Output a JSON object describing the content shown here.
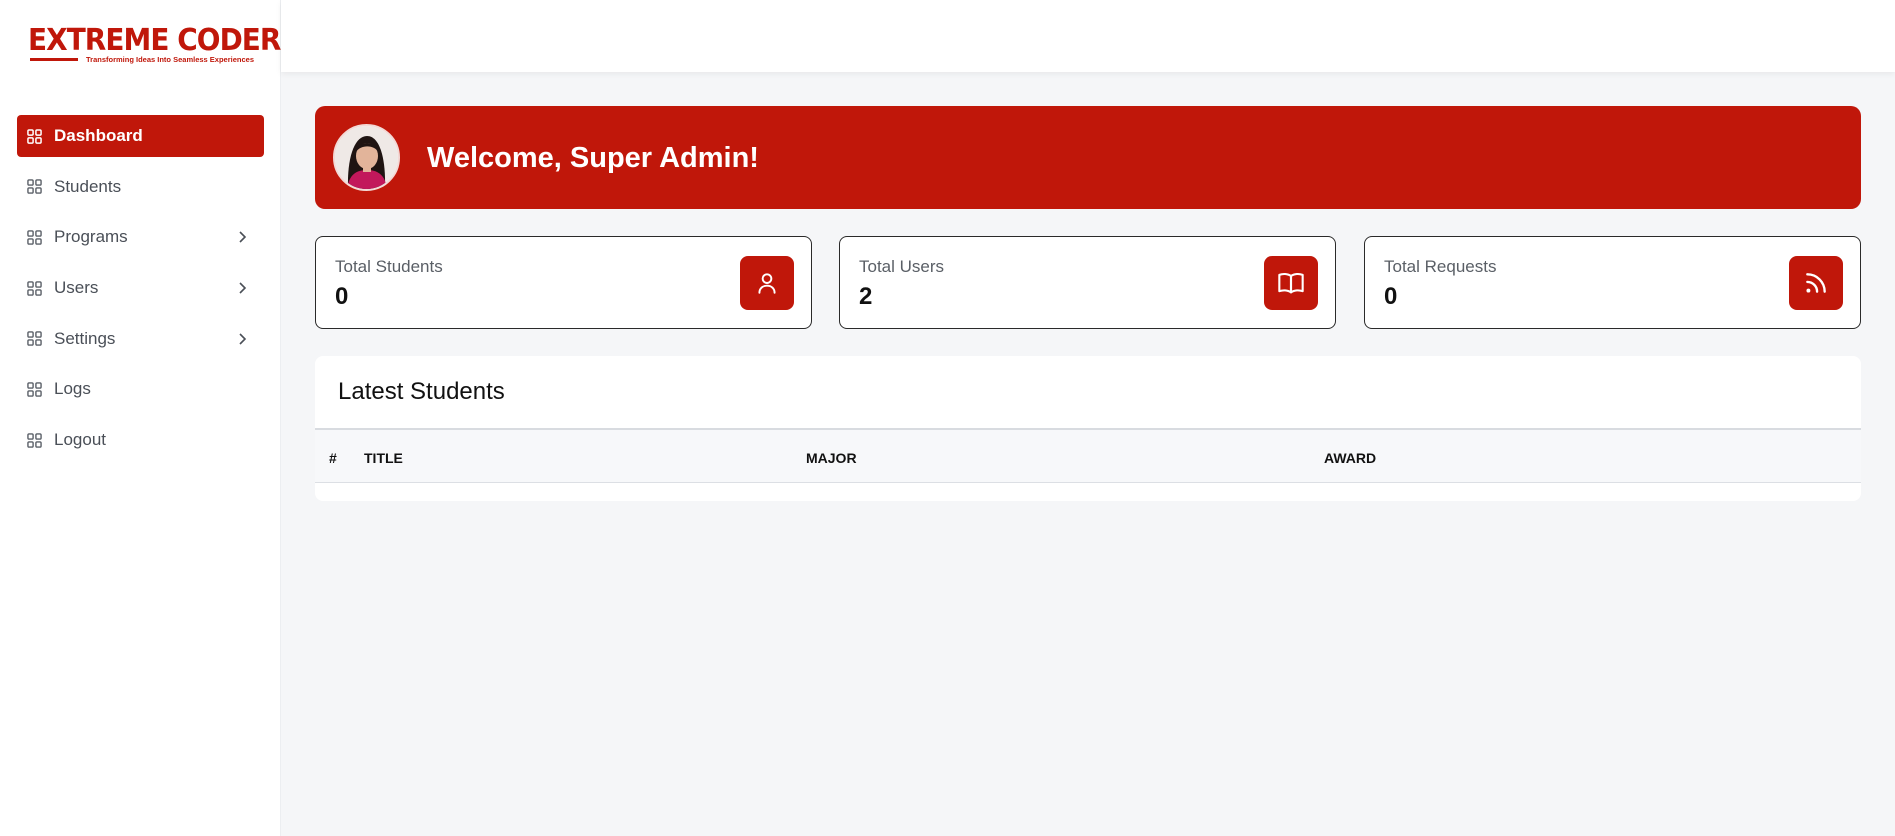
{
  "brand": {
    "name": "EXTREME CODERS",
    "tagline": "Transforming Ideas Into Seamless Experiences",
    "accent_color": "#c0170a"
  },
  "sidebar": {
    "items": [
      {
        "label": "Dashboard",
        "active": true,
        "has_submenu": false
      },
      {
        "label": "Students",
        "active": false,
        "has_submenu": false
      },
      {
        "label": "Programs",
        "active": false,
        "has_submenu": true
      },
      {
        "label": "Users",
        "active": false,
        "has_submenu": true
      },
      {
        "label": "Settings",
        "active": false,
        "has_submenu": true
      },
      {
        "label": "Logs",
        "active": false,
        "has_submenu": false
      },
      {
        "label": "Logout",
        "active": false,
        "has_submenu": false
      }
    ]
  },
  "welcome": {
    "title": "Welcome, Super Admin!"
  },
  "stats": [
    {
      "label": "Total Students",
      "value": "0",
      "icon": "user-icon"
    },
    {
      "label": "Total Users",
      "value": "2",
      "icon": "book-icon"
    },
    {
      "label": "Total Requests",
      "value": "0",
      "icon": "rss-icon"
    }
  ],
  "latest_students": {
    "title": "Latest Students",
    "columns": [
      "#",
      "TITLE",
      "MAJOR",
      "AWARD"
    ],
    "rows": []
  }
}
